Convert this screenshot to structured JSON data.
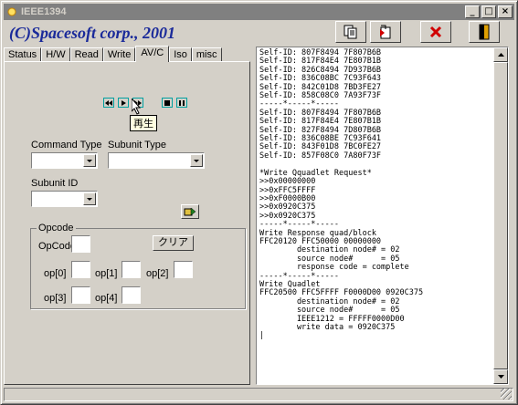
{
  "window": {
    "title": "IEEE1394",
    "minimize_glyph": "_",
    "maximize_glyph": "□",
    "close_glyph": "×"
  },
  "brand": "(C)Spacesoft corp., 2001",
  "toolbar": {
    "buttons": [
      {
        "icon": "copy-icon"
      },
      {
        "icon": "paste-icon"
      },
      {
        "icon": "clear-icon",
        "color": "#d00000"
      },
      {
        "icon": "exit-door-icon",
        "color": "#e0a000"
      }
    ]
  },
  "tabs": [
    "Status",
    "H/W",
    "Read",
    "Write",
    "AV/C",
    "Iso",
    "misc"
  ],
  "active_tab": "AV/C",
  "media": {
    "buttons": [
      "rewind-icon",
      "play-icon",
      "fast-forward-icon",
      "stop-icon",
      "pause-icon"
    ],
    "tooltip": "再生"
  },
  "form": {
    "command_type_label": "Command Type",
    "subunit_type_label": "Subunit Type",
    "subunit_id_label": "Subunit ID",
    "command_type_value": "",
    "subunit_type_value": "",
    "subunit_id_value": ""
  },
  "opcode": {
    "group_title": "Opcode",
    "opcode_label": "OpCode",
    "clear_button": "クリア",
    "operands": [
      "op[0]",
      "op[1]",
      "op[2]",
      "op[3]",
      "op[4]"
    ]
  },
  "log": {
    "lines": [
      "Self-ID: 807F8494 7F807B6B",
      "Self-ID: 817F84E4 7E807B1B",
      "Self-ID: 826C8494 7D937B6B",
      "Self-ID: 836C08BC 7C93F643",
      "Self-ID: 842C01D8 7BD3FE27",
      "Self-ID: 858C08C0 7A93F73F",
      "-----*-----*-----",
      "Self-ID: 807F8494 7F807B6B",
      "Self-ID: 817F84E4 7E807B1B",
      "Self-ID: 827F8494 7D807B6B",
      "Self-ID: 836C08BE 7C93F641",
      "Self-ID: 843F01D8 7BC0FE27",
      "Self-ID: 857F08C0 7A80F73F",
      "",
      "*Write Qquadlet Request*",
      ">>0x00000000",
      ">>0xFFC5FFFF",
      ">>0xF0000B00",
      ">>0x0920C375",
      ">>0x0920C375",
      "-----*-----*-----",
      "Write Response quad/block",
      "FFC20120 FFC50000 00000000",
      "        destination node# = 02",
      "        source node#      = 05",
      "        response code = complete",
      "-----*-----*-----",
      "Write Quadlet",
      "FFC20500 FFC5FFFF F0000D00 0920C375",
      "        destination node# = 02",
      "        source node#      = 05",
      "        IEEE1212 = FFFFF0000D00",
      "        write data = 0920C375",
      "|"
    ]
  }
}
